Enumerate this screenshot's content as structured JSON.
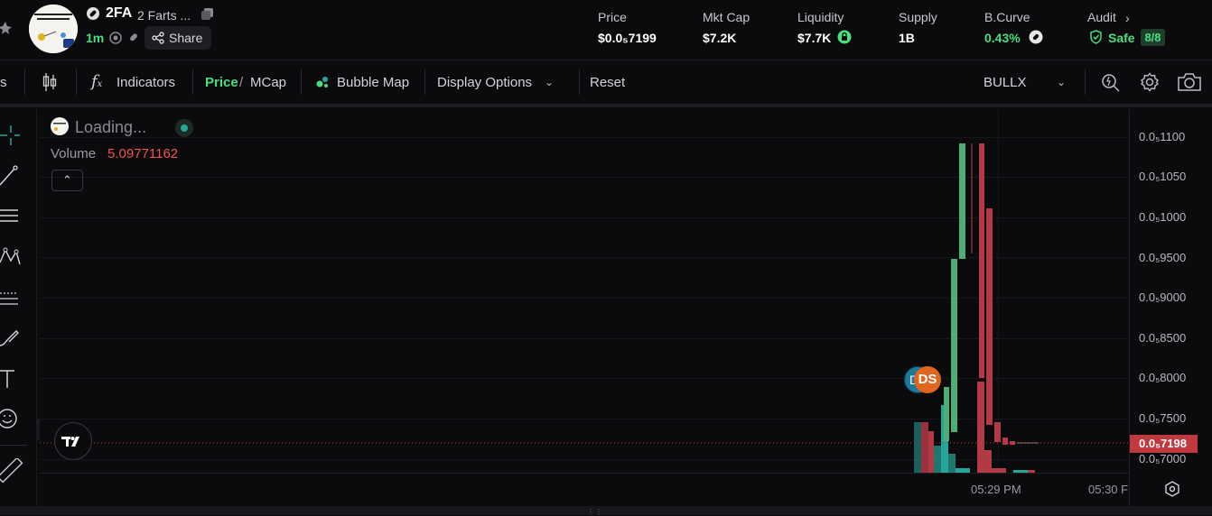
{
  "header": {
    "ticker": "2FA",
    "name": "2 Farts ...",
    "age": "1m",
    "share_label": "Share",
    "logo_text": "2 FART AUTHENTICATION",
    "stats": [
      {
        "label": "Price",
        "value": "$0.0₅7199",
        "color": "#ffffff"
      },
      {
        "label": "Mkt Cap",
        "value": "$7.2K",
        "color": "#ffffff"
      },
      {
        "label": "Liquidity",
        "value": "$7.7K",
        "color": "#ffffff"
      },
      {
        "label": "Supply",
        "value": "1B",
        "color": "#ffffff"
      },
      {
        "label": "B.Curve",
        "value": "0.43%",
        "color": "#4ade80"
      },
      {
        "label": "Audit",
        "value": "Safe",
        "color": "#4ade80"
      }
    ],
    "audit_badge": "8/8"
  },
  "toolbar": {
    "indicators": "Indicators",
    "price": "Price",
    "slash": "/",
    "mcap": "MCap",
    "bubble_map": "Bubble Map",
    "display_options": "Display Options",
    "reset": "Reset",
    "source": "BULLX",
    "left_cut": "s"
  },
  "chart": {
    "title": "Loading...",
    "volume_label": "Volume",
    "volume_value": "5.09771162",
    "current_price": "0.0₅7198",
    "marker": "DS",
    "marker_left": "D",
    "x_labels": [
      "05:29 PM",
      "05:30 F"
    ],
    "y_labels": [
      "0.0₅1100",
      "0.0₅1050",
      "0.0₅1000",
      "0.0₅9500",
      "0.0₅9000",
      "0.0₅8500",
      "0.0₅8000",
      "0.0₅7500",
      "0.0₅7000"
    ],
    "colors": {
      "up": "#26a69a",
      "up_bar": "#4caf76",
      "down": "#b23a45",
      "price_tag": "#c0393f"
    }
  }
}
